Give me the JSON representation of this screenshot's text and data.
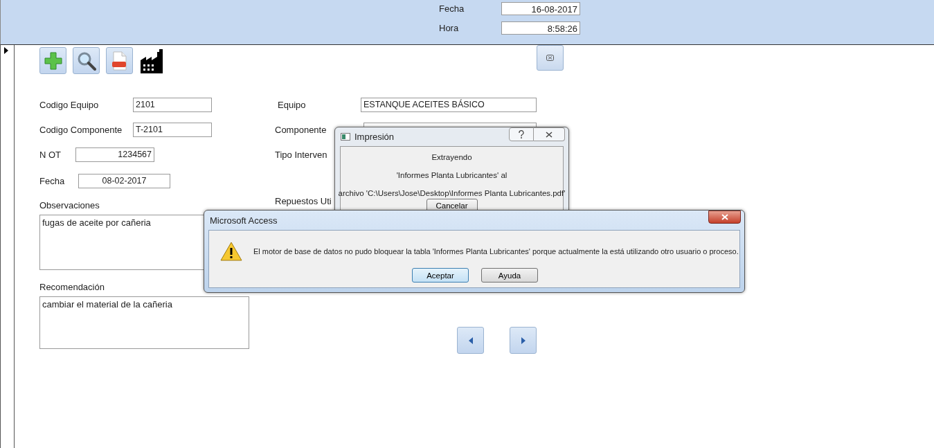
{
  "header": {
    "fields": [
      {
        "label": "Fecha",
        "value": "16-08-2017"
      },
      {
        "label": "Hora",
        "value": "8:58:26"
      }
    ]
  },
  "toolbar": {
    "tools": [
      {
        "kind": "add"
      },
      {
        "kind": "search"
      },
      {
        "kind": "pdf"
      },
      {
        "kind": "factory"
      }
    ]
  },
  "form": {
    "left_fields": [
      {
        "label": "Codigo Equipo",
        "value": "2101",
        "kind": "text"
      },
      {
        "label": "Codigo Componente",
        "value": "T-2101",
        "kind": "text"
      },
      {
        "label": "N OT",
        "value": "1234567",
        "kind": "number"
      },
      {
        "label": "Fecha",
        "value": "08-02-2017",
        "kind": "date"
      }
    ],
    "notes": [
      {
        "label": "Observaciones",
        "value": "fugas de aceite por cañeria"
      },
      {
        "label": "Recomendación",
        "value": "cambiar el material de la cañeria"
      }
    ],
    "right_fields": [
      {
        "label": "Equipo",
        "value": "ESTANQUE ACEITES BÁSICO",
        "kind": "text"
      },
      {
        "label": "Componente",
        "kind": "text"
      },
      {
        "label": "Tipo Interven",
        "kind": "label"
      },
      {
        "label": "Repuestos Uti",
        "kind": "label"
      }
    ]
  },
  "print_dialog": {
    "title": "Impresión",
    "lines": [
      "Extrayendo",
      "'Informes Planta Lubricantes' al",
      "archivo 'C:\\Users\\Jose\\Desktop\\Informes Planta Lubricantes.pdf'"
    ],
    "button": "Cancelar"
  },
  "alert": {
    "title": "Microsoft Access",
    "message": "El motor de base de datos no pudo bloquear la tabla 'Informes Planta Lubricantes' porque actualmente la está utilizando otro usuario o proceso.",
    "buttons": [
      {
        "label": "Aceptar",
        "default": true
      },
      {
        "label": "Ayuda",
        "default": false
      }
    ]
  }
}
